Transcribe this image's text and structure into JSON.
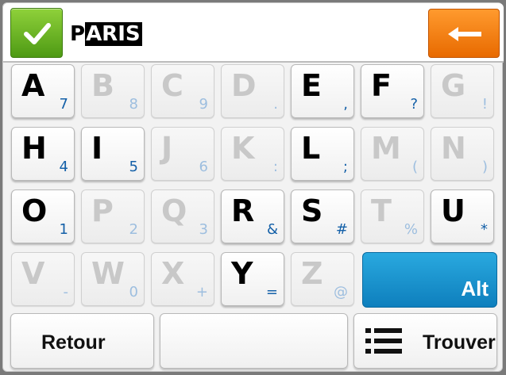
{
  "topbar": {
    "ok_icon": "checkmark-icon",
    "input_prefix": "P",
    "input_selected": "ARIS",
    "back_icon": "arrow-left-icon",
    "colors": {
      "ok": "#5aa81c",
      "back": "#f07c10"
    }
  },
  "keys": [
    {
      "main": "A",
      "sub": "7",
      "enabled": true
    },
    {
      "main": "B",
      "sub": "8",
      "enabled": false
    },
    {
      "main": "C",
      "sub": "9",
      "enabled": false
    },
    {
      "main": "D",
      "sub": ".",
      "enabled": false
    },
    {
      "main": "E",
      "sub": ",",
      "enabled": true
    },
    {
      "main": "F",
      "sub": "?",
      "enabled": true
    },
    {
      "main": "G",
      "sub": "!",
      "enabled": false
    },
    {
      "main": "H",
      "sub": "4",
      "enabled": true
    },
    {
      "main": "I",
      "sub": "5",
      "enabled": true
    },
    {
      "main": "J",
      "sub": "6",
      "enabled": false
    },
    {
      "main": "K",
      "sub": ":",
      "enabled": false
    },
    {
      "main": "L",
      "sub": ";",
      "enabled": true
    },
    {
      "main": "M",
      "sub": "(",
      "enabled": false
    },
    {
      "main": "N",
      "sub": ")",
      "enabled": false
    },
    {
      "main": "O",
      "sub": "1",
      "enabled": true
    },
    {
      "main": "P",
      "sub": "2",
      "enabled": false
    },
    {
      "main": "Q",
      "sub": "3",
      "enabled": false
    },
    {
      "main": "R",
      "sub": "&",
      "enabled": true
    },
    {
      "main": "S",
      "sub": "#",
      "enabled": true
    },
    {
      "main": "T",
      "sub": "%",
      "enabled": false
    },
    {
      "main": "U",
      "sub": "*",
      "enabled": true
    },
    {
      "main": "V",
      "sub": "-",
      "enabled": false
    },
    {
      "main": "W",
      "sub": "0",
      "enabled": false
    },
    {
      "main": "X",
      "sub": "+",
      "enabled": false
    },
    {
      "main": "Y",
      "sub": "=",
      "enabled": true
    },
    {
      "main": "Z",
      "sub": "@",
      "enabled": false
    }
  ],
  "alt_key": {
    "label": "Alt",
    "color": "#1a96d2"
  },
  "bottom": {
    "retour_label": "Retour",
    "space_label": "",
    "trouver_label": "Trouver",
    "trouver_icon": "list-icon"
  }
}
